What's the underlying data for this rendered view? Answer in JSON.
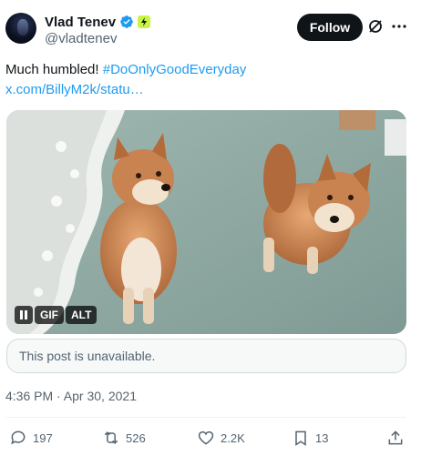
{
  "author": {
    "display_name": "Vlad Tenev",
    "handle": "@vladtenev",
    "verified": true,
    "affiliate_badge_color": "#c8f542"
  },
  "header": {
    "follow_label": "Follow",
    "grok_icon": "grok-icon",
    "more_icon": "more-horizontal-icon"
  },
  "post": {
    "text": "Much humbled! ",
    "hashtag": "#DoOnlyGoodEveryday",
    "link": "x.com/BillyM2k/statu…"
  },
  "media": {
    "pause_icon": "pause-icon",
    "gif_label": "GIF",
    "alt_label": "ALT"
  },
  "quote": {
    "unavailable_text": "This post is unavailable."
  },
  "meta": {
    "timestamp": "4:36 PM · Apr 30, 2021"
  },
  "actions": {
    "replies": "197",
    "reposts": "526",
    "likes": "2.2K",
    "bookmarks": "13"
  },
  "colors": {
    "link": "#1d9bf0",
    "secondary_text": "#536471",
    "follow_bg": "#0f1419"
  }
}
